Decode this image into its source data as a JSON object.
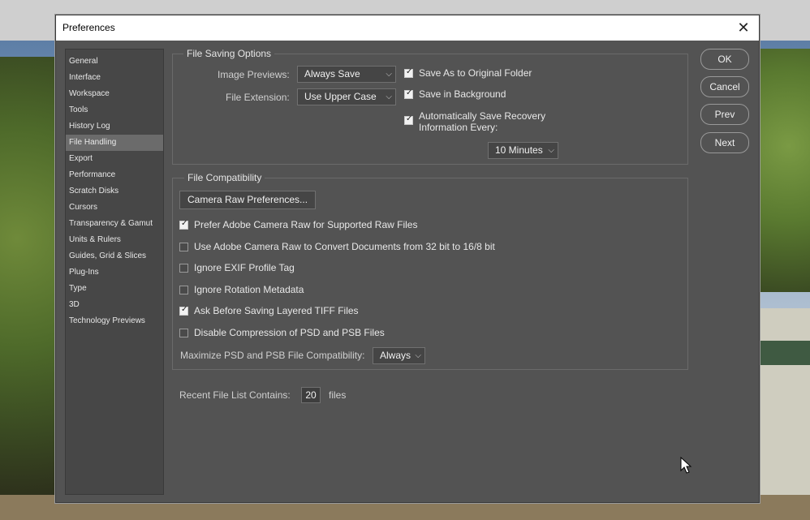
{
  "window": {
    "title": "Preferences",
    "close_glyph": "✕"
  },
  "sidebar": {
    "items": [
      {
        "label": "General",
        "active": false
      },
      {
        "label": "Interface",
        "active": false
      },
      {
        "label": "Workspace",
        "active": false
      },
      {
        "label": "Tools",
        "active": false
      },
      {
        "label": "History Log",
        "active": false
      },
      {
        "label": "File Handling",
        "active": true
      },
      {
        "label": "Export",
        "active": false
      },
      {
        "label": "Performance",
        "active": false
      },
      {
        "label": "Scratch Disks",
        "active": false
      },
      {
        "label": "Cursors",
        "active": false
      },
      {
        "label": "Transparency & Gamut",
        "active": false
      },
      {
        "label": "Units & Rulers",
        "active": false
      },
      {
        "label": "Guides, Grid & Slices",
        "active": false
      },
      {
        "label": "Plug-Ins",
        "active": false
      },
      {
        "label": "Type",
        "active": false
      },
      {
        "label": "3D",
        "active": false
      },
      {
        "label": "Technology Previews",
        "active": false
      }
    ]
  },
  "buttons": {
    "ok": "OK",
    "cancel": "Cancel",
    "prev": "Prev",
    "next": "Next"
  },
  "file_saving": {
    "title": "File Saving Options",
    "image_previews_label": "Image Previews:",
    "image_previews_value": "Always Save",
    "file_extension_label": "File Extension:",
    "file_extension_value": "Use Upper Case",
    "save_original_folder": {
      "label": "Save As to Original Folder",
      "checked": true
    },
    "save_background": {
      "label": "Save in Background",
      "checked": true
    },
    "auto_save": {
      "label_line1": "Automatically Save Recovery",
      "label_line2": "Information Every:",
      "checked": true
    },
    "auto_save_interval": "10 Minutes"
  },
  "file_compat": {
    "title": "File Compatibility",
    "camera_raw_button": "Camera Raw Preferences...",
    "options": [
      {
        "label": "Prefer Adobe Camera Raw for Supported Raw Files",
        "checked": true
      },
      {
        "label": "Use Adobe Camera Raw to Convert Documents from 32 bit to 16/8 bit",
        "checked": false
      },
      {
        "label": "Ignore EXIF Profile Tag",
        "checked": false
      },
      {
        "label": "Ignore Rotation Metadata",
        "checked": false
      },
      {
        "label": "Ask Before Saving Layered TIFF Files",
        "checked": true
      },
      {
        "label": "Disable Compression of PSD and PSB Files",
        "checked": false
      }
    ],
    "maximize_label": "Maximize PSD and PSB File Compatibility:",
    "maximize_value": "Always"
  },
  "recent_files": {
    "label": "Recent File List Contains:",
    "value": "20",
    "suffix": "files"
  },
  "icons": {
    "chevron": "chevron-down-icon",
    "check": "checkmark-icon"
  },
  "colors": {
    "dialog_bg": "#535353",
    "sidebar_bg": "#474747",
    "active_item": "#6b6b6b"
  }
}
